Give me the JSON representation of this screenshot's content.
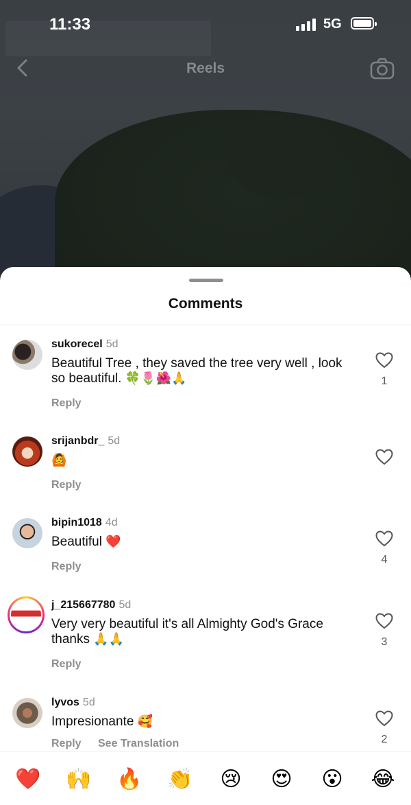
{
  "status": {
    "time": "11:33",
    "network": "5G"
  },
  "header": {
    "title": "Reels"
  },
  "sheet": {
    "title": "Comments"
  },
  "comments": [
    {
      "user": "sukorecel",
      "age": "5d",
      "text": "Beautiful Tree , they saved  the tree very well , look so  beautiful.",
      "emoji": "🍀🌷🌺🙏",
      "reply": "Reply",
      "likes": "1"
    },
    {
      "user": "srijanbdr_",
      "age": "5d",
      "text": "",
      "emoji": "🙆",
      "reply": "Reply",
      "likes": ""
    },
    {
      "user": "bipin1018",
      "age": "4d",
      "text": "Beautiful",
      "emoji": "❤️",
      "reply": "Reply",
      "likes": "4"
    },
    {
      "user": "j_215667780",
      "age": "5d",
      "text": "Very very beautiful it's all Almighty God's Grace thanks",
      "emoji": "🙏🙏",
      "reply": "Reply",
      "likes": "3"
    },
    {
      "user": "lyvos",
      "age": "5d",
      "text": "Impresionante",
      "emoji": "🥰",
      "reply": "Reply",
      "translate": "See Translation",
      "likes": "2"
    }
  ],
  "reactions": [
    "❤️",
    "🙌",
    "🔥",
    "👏",
    "😢",
    "😍",
    "😮",
    "😂"
  ],
  "colors": {
    "accent_like": "#ed4956",
    "muted": "#8e8e8e",
    "sheet_bg": "#ffffff"
  }
}
